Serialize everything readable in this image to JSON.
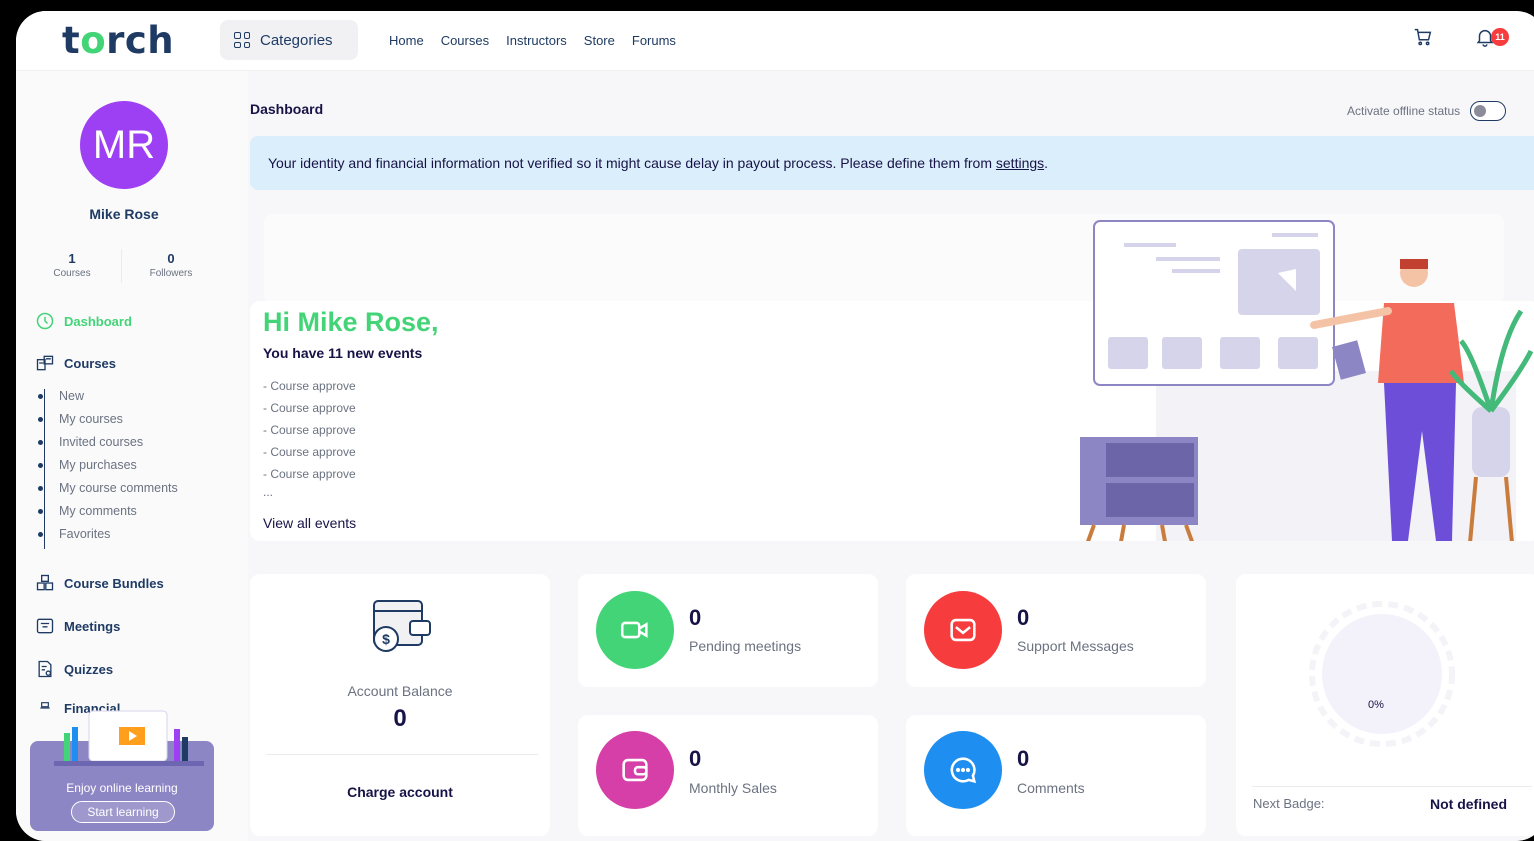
{
  "header": {
    "logo": "torch",
    "categories_label": "Categories",
    "nav": [
      "Home",
      "Courses",
      "Instructors",
      "Store",
      "Forums"
    ],
    "notification_count": "11"
  },
  "sidebar": {
    "avatar_initials": "MR",
    "username": "Mike Rose",
    "stats": [
      {
        "value": "1",
        "label": "Courses"
      },
      {
        "value": "0",
        "label": "Followers"
      }
    ],
    "menu": [
      {
        "label": "Dashboard",
        "icon": "dashboard-icon",
        "active": true
      },
      {
        "label": "Courses",
        "icon": "courses-icon"
      },
      {
        "label": "Course Bundles",
        "icon": "bundles-icon"
      },
      {
        "label": "Meetings",
        "icon": "meetings-icon"
      },
      {
        "label": "Quizzes",
        "icon": "quizzes-icon"
      },
      {
        "label": "Financial",
        "icon": "financial-icon"
      }
    ],
    "course_submenu": [
      "New",
      "My courses",
      "Invited courses",
      "My purchases",
      "My course comments",
      "My comments",
      "Favorites"
    ],
    "promo": {
      "title": "Enjoy online learning",
      "button": "Start learning"
    }
  },
  "main": {
    "page_title": "Dashboard",
    "offline_label": "Activate offline status",
    "offline_enabled": false,
    "alert_text": "Your identity and financial information not verified so it might cause delay in payout process. Please define them from ",
    "alert_link": "settings",
    "alert_end": ".",
    "greeting": "Hi Mike Rose,",
    "events_title": "You have 11 new events",
    "events": [
      "- Course approve",
      "- Course approve",
      "- Course approve",
      "- Course approve",
      "- Course approve",
      "..."
    ],
    "view_all": "View all events",
    "balance": {
      "label": "Account Balance",
      "value": "0",
      "action": "Charge account"
    },
    "stats": [
      {
        "value": "0",
        "label": "Pending meetings",
        "icon": "video-icon",
        "color": "#43d477"
      },
      {
        "value": "0",
        "label": "Support Messages",
        "icon": "mail-icon",
        "color": "#f63c3c"
      },
      {
        "value": "0",
        "label": "Monthly Sales",
        "icon": "wallet-icon",
        "color": "#d53fa7"
      },
      {
        "value": "0",
        "label": "Comments",
        "icon": "chat-icon",
        "color": "#1e8ef0"
      }
    ],
    "badge": {
      "progress": "0%",
      "next_label": "Next Badge:",
      "next_value": "Not defined"
    }
  },
  "colors": {
    "primary": "#43d477",
    "navy": "#1f3b64",
    "accent_purple": "#9d3ff2",
    "alert_bg": "#dbeefb"
  }
}
